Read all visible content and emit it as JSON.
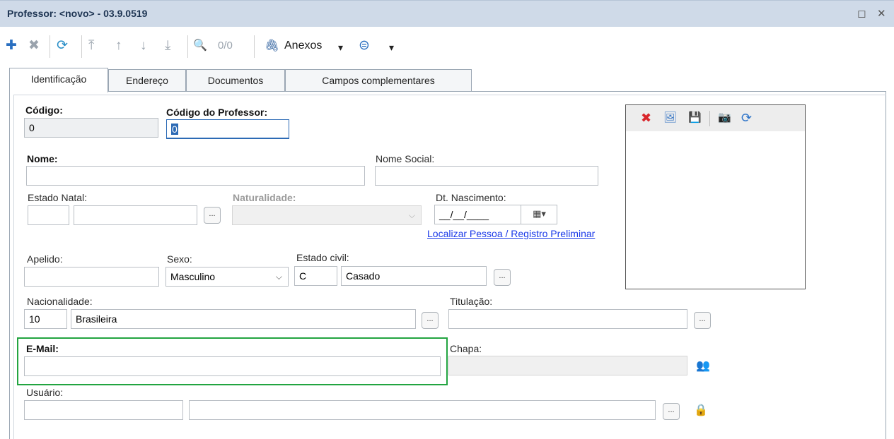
{
  "window": {
    "title": "Professor: <novo> - 03.9.0519",
    "maximize_glyph": "◻",
    "close_glyph": "✕"
  },
  "toolbar": {
    "icons": {
      "add": "✚",
      "delete": "✖",
      "refresh": "⟳",
      "first": "⤒",
      "prev": "↑",
      "next": "↓",
      "last": "⤓",
      "search": "🔍",
      "attach": "🖇",
      "more": "⊜",
      "caret": "▾"
    },
    "record_counter": "0/0",
    "attachments_label": "Anexos"
  },
  "tabs": [
    "Identificação",
    "Endereço",
    "Documentos",
    "Campos complementares"
  ],
  "form": {
    "codigo": {
      "label": "Código:",
      "value": "0"
    },
    "codigo_professor": {
      "label": "Código do Professor:",
      "value": "0"
    },
    "nome": {
      "label": "Nome:",
      "value": ""
    },
    "nome_social": {
      "label": "Nome Social:",
      "value": ""
    },
    "estado_natal": {
      "label": "Estado Natal:",
      "code": "",
      "name": ""
    },
    "naturalidade": {
      "label": "Naturalidade:",
      "value": ""
    },
    "dt_nascimento": {
      "label": "Dt. Nascimento:",
      "value": "__/__/____",
      "calendar_icon": "▦▾"
    },
    "localizar_link": "Localizar Pessoa / Registro Preliminar",
    "apelido": {
      "label": "Apelido:",
      "value": ""
    },
    "sexo": {
      "label": "Sexo:",
      "value": "Masculino"
    },
    "estado_civil": {
      "label": "Estado civil:",
      "code": "C",
      "name": "Casado"
    },
    "nacionalidade": {
      "label": "Nacionalidade:",
      "code": "10",
      "name": "Brasileira"
    },
    "titulacao": {
      "label": "Titulação:",
      "value": ""
    },
    "email": {
      "label": "E-Mail:",
      "value": ""
    },
    "chapa": {
      "label": "Chapa:",
      "value": "",
      "icon": "👥"
    },
    "usuario": {
      "label": "Usuário:",
      "code": "",
      "name": "",
      "icon": "🔒"
    },
    "ellipsis": "...",
    "chevron": "⌵"
  },
  "photo_toolbar": {
    "icons": {
      "remove": "✖",
      "image": "🖼",
      "save": "💾",
      "camera": "📷",
      "rotate": "⟳"
    },
    "colors": {
      "remove": "#d9262b",
      "image": "#3b78c4",
      "save": "#9a9a9a",
      "camera": "#3a3a3a",
      "rotate": "#2e74c9"
    }
  },
  "colors": {
    "highlight_border": "#22a440",
    "link": "#1a39e8",
    "titlebar": "#cfdae8"
  }
}
